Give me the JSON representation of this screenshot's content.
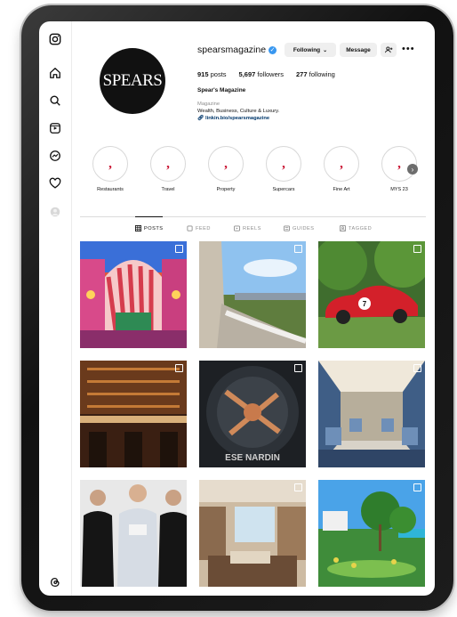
{
  "rail_icons": [
    "instagram-icon",
    "home-icon",
    "search-icon",
    "explore-icon",
    "messenger-icon",
    "heart-icon",
    "avatar",
    "threads-icon"
  ],
  "profile": {
    "logo_text": "SPEARS",
    "username": "spearsmagazine",
    "following_button": "Following",
    "message_button": "Message",
    "posts_count": "915",
    "posts_label": "posts",
    "followers_count": "5,697",
    "followers_label": "followers",
    "following_count": "277",
    "following_label": "following",
    "full_name": "Spear's Magazine",
    "category": "Magazine",
    "bio": "Wealth, Business, Culture & Luxury.",
    "link": "linkin.bio/spearsmagazine"
  },
  "highlights": [
    {
      "label": "Restaurants"
    },
    {
      "label": "Travel"
    },
    {
      "label": "Property"
    },
    {
      "label": "Supercars"
    },
    {
      "label": "Fine Art"
    },
    {
      "label": "MYS 23"
    }
  ],
  "tabs": [
    {
      "label": "POSTS",
      "active": true
    },
    {
      "label": "FEED",
      "active": false
    },
    {
      "label": "REELS",
      "active": false
    },
    {
      "label": "GUIDES",
      "active": false
    },
    {
      "label": "TAGGED",
      "active": false
    }
  ],
  "grid_posts": [
    {
      "subject": "colorful-building-facade",
      "multi": true
    },
    {
      "subject": "luxury-balcony-view",
      "multi": true
    },
    {
      "subject": "red-sports-car",
      "multi": true
    },
    {
      "subject": "restaurant-bar",
      "multi": true
    },
    {
      "subject": "luxury-watch",
      "multi": true
    },
    {
      "subject": "train-interior",
      "multi": true
    },
    {
      "subject": "three-men-portrait",
      "multi": false
    },
    {
      "subject": "hotel-suite",
      "multi": true
    },
    {
      "subject": "tropical-resort",
      "multi": true
    }
  ],
  "grid_watermark": "ESE NARDIN",
  "car_number": "7",
  "colors": {
    "accent": "#3897f0",
    "brand_red": "#c8102e",
    "link": "#00376b"
  }
}
